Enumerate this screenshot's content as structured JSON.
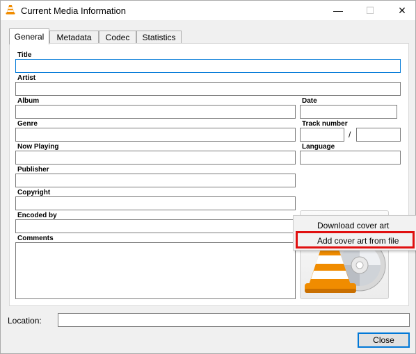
{
  "window": {
    "title": "Current Media Information",
    "minimize_glyph": "—",
    "maximize_glyph": "☐",
    "close_glyph": "✕"
  },
  "tabs": [
    {
      "label": "General",
      "active": true
    },
    {
      "label": "Metadata",
      "active": false
    },
    {
      "label": "Codec",
      "active": false
    },
    {
      "label": "Statistics",
      "active": false
    }
  ],
  "general": {
    "title_label": "Title",
    "title_value": "",
    "artist_label": "Artist",
    "artist_value": "",
    "album_label": "Album",
    "album_value": "",
    "date_label": "Date",
    "date_value": "",
    "genre_label": "Genre",
    "genre_value": "",
    "track_label": "Track number",
    "track_value": "",
    "track_total_value": "",
    "track_separator": "/",
    "now_playing_label": "Now Playing",
    "now_playing_value": "",
    "language_label": "Language",
    "language_value": "",
    "publisher_label": "Publisher",
    "publisher_value": "",
    "copyright_label": "Copyright",
    "copyright_value": "",
    "encoded_by_label": "Encoded by",
    "encoded_by_value": "",
    "comments_label": "Comments",
    "comments_value": ""
  },
  "cover_art": {
    "icon": "vlc-cone-disc-icon"
  },
  "context_menu": {
    "items": [
      {
        "label": "Download cover art"
      },
      {
        "label": "Add cover art from file",
        "highlighted": true
      }
    ],
    "highlight_color": "#e01010"
  },
  "footer": {
    "location_label": "Location:",
    "location_value": "",
    "close_label": "Close"
  },
  "colors": {
    "accent": "#0078d7",
    "window_bg": "#f0f0f0",
    "vlc_orange": "#f08c00"
  }
}
